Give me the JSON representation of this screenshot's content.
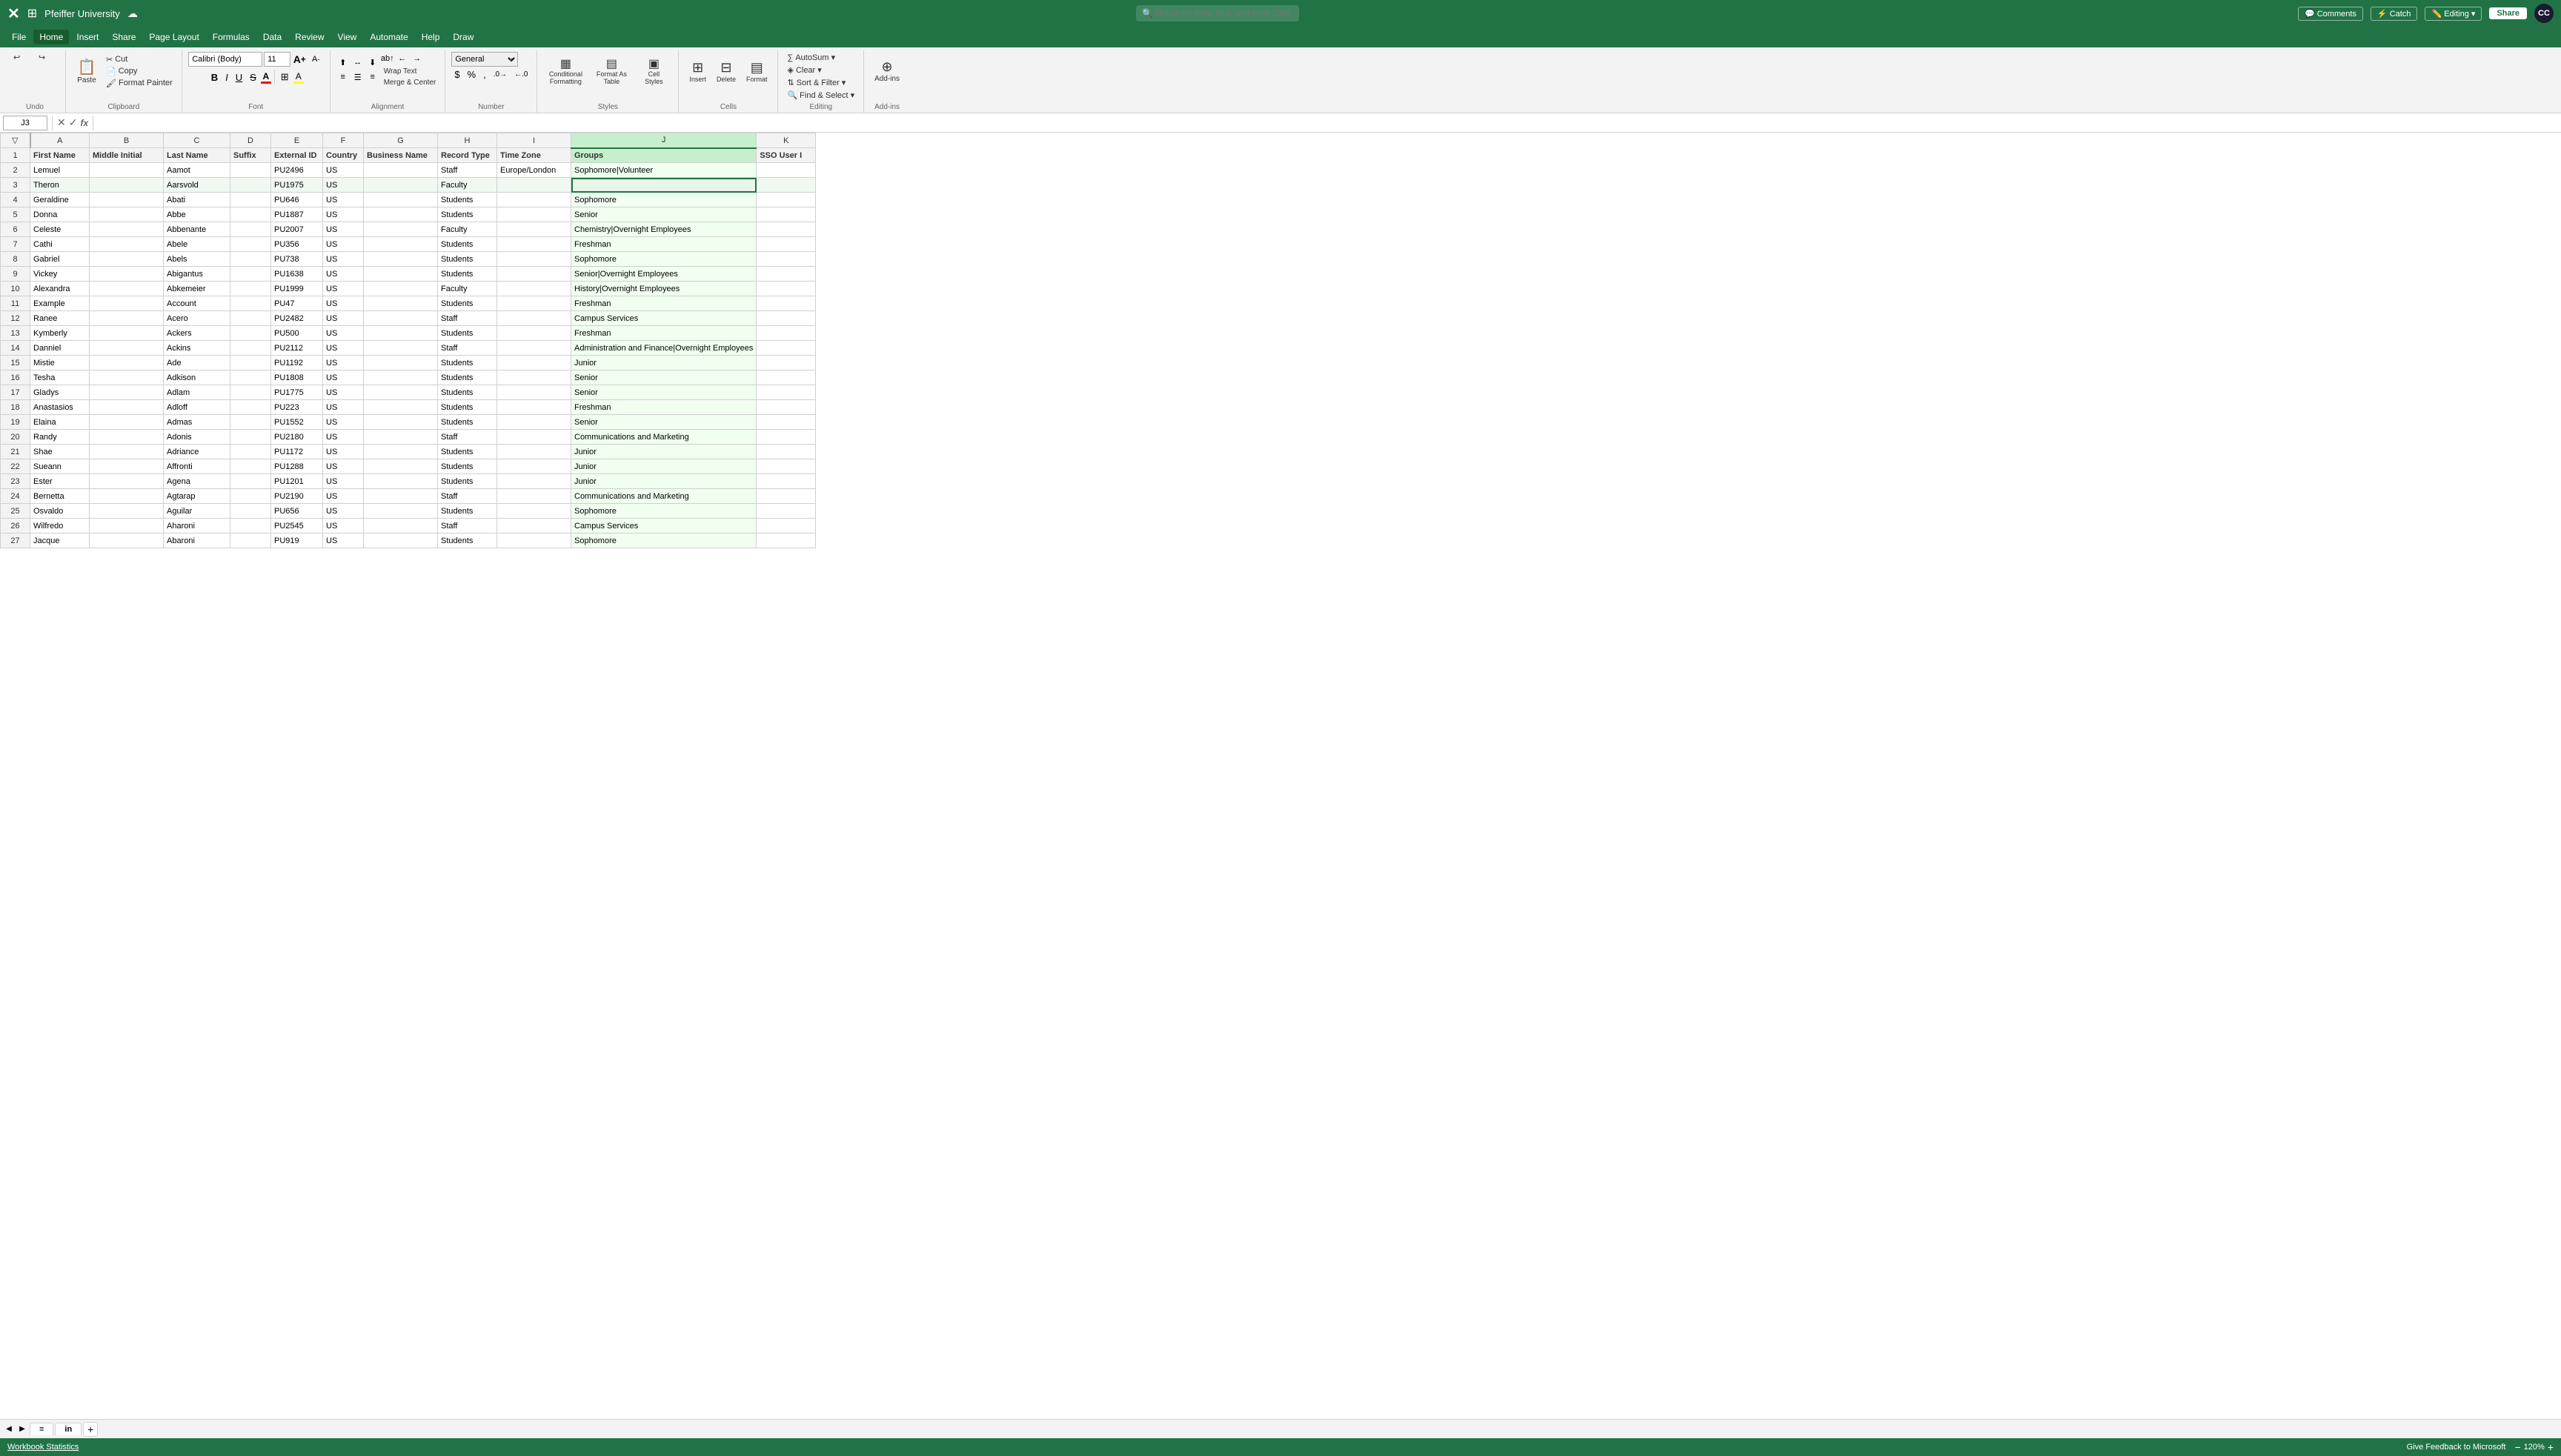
{
  "titleBar": {
    "logo": "X",
    "filename": "Pfeiffer University",
    "cloudIcon": "☁",
    "searchPlaceholder": "Search for tools, help, and more (Option + Q)",
    "catchLabel": "Catch",
    "editingLabel": "Editing",
    "shareLabel": "Share",
    "commentsLabel": "Comments",
    "avatarLabel": "CC"
  },
  "menuBar": {
    "items": [
      "File",
      "Home",
      "Insert",
      "Share",
      "Page Layout",
      "Formulas",
      "Data",
      "Review",
      "View",
      "Automate",
      "Help",
      "Draw"
    ]
  },
  "ribbon": {
    "undo": "↩",
    "redo": "↪",
    "clipboard": {
      "paste": "Paste",
      "cut": "Cut",
      "copy": "Copy",
      "formatPainter": "Format Painter"
    },
    "font": {
      "name": "Calibri (Body)",
      "size": "11",
      "increaseSize": "A",
      "decreaseSize": "A",
      "bold": "B",
      "italic": "I",
      "underline": "U",
      "strikethrough": "S",
      "fontColor": "A",
      "highlightColor": "A"
    },
    "alignment": {
      "wrapText": "Wrap Text",
      "mergeCenter": "Merge & Center",
      "alignLeft": "≡",
      "alignCenter": "≡",
      "alignRight": "≡",
      "indentDecrease": "←",
      "indentIncrease": "→"
    },
    "number": {
      "format": "General",
      "currency": "$",
      "percent": "%",
      "comma": ",",
      "decIncrease": "↑",
      "decDecrease": "↓"
    },
    "styles": {
      "conditional": "Conditional Formatting",
      "formatAsTable": "Format As Table",
      "cellStyles": "Cell Styles"
    },
    "cells": {
      "insert": "Insert",
      "delete": "Delete",
      "format": "Format"
    },
    "editing": {
      "autoSum": "AutoSum",
      "clear": "Clear",
      "sort": "Sort & Filter",
      "findSelect": "Find & Select"
    },
    "addins": {
      "label": "Add-ins"
    }
  },
  "formulaBar": {
    "cellRef": "J3",
    "cancel": "✕",
    "confirm": "✓",
    "fx": "fx",
    "formula": ""
  },
  "columns": {
    "rowHeader": "#",
    "headers": [
      "A",
      "B",
      "C",
      "D",
      "E",
      "F",
      "G",
      "H",
      "I",
      "J",
      "K"
    ],
    "colLabels": [
      "First Name",
      "Middle Initial",
      "Last Name",
      "Suffix",
      "External ID",
      "Country",
      "Business Name",
      "Record Type",
      "Time Zone",
      "Groups",
      "SSO User I"
    ]
  },
  "rows": [
    {
      "num": 2,
      "cells": [
        "Lemuel",
        "",
        "Aamot",
        "",
        "PU2496",
        "US",
        "",
        "Staff",
        "Europe/London",
        "Sophomore|Volunteer",
        ""
      ]
    },
    {
      "num": 3,
      "cells": [
        "Theron",
        "",
        "Aarsvold",
        "",
        "PU1975",
        "US",
        "",
        "Faculty",
        "",
        "",
        ""
      ],
      "selected": true
    },
    {
      "num": 4,
      "cells": [
        "Geraldine",
        "",
        "Abati",
        "",
        "PU646",
        "US",
        "",
        "Students",
        "",
        "Sophomore",
        ""
      ]
    },
    {
      "num": 5,
      "cells": [
        "Donna",
        "",
        "Abbe",
        "",
        "PU1887",
        "US",
        "",
        "Students",
        "",
        "Senior",
        ""
      ]
    },
    {
      "num": 6,
      "cells": [
        "Celeste",
        "",
        "Abbenante",
        "",
        "PU2007",
        "US",
        "",
        "Faculty",
        "",
        "Chemistry|Overnight Employees",
        ""
      ]
    },
    {
      "num": 7,
      "cells": [
        "Cathi",
        "",
        "Abele",
        "",
        "PU356",
        "US",
        "",
        "Students",
        "",
        "Freshman",
        ""
      ]
    },
    {
      "num": 8,
      "cells": [
        "Gabriel",
        "",
        "Abels",
        "",
        "PU738",
        "US",
        "",
        "Students",
        "",
        "Sophomore",
        ""
      ]
    },
    {
      "num": 9,
      "cells": [
        "Vickey",
        "",
        "Abigantus",
        "",
        "PU1638",
        "US",
        "",
        "Students",
        "",
        "Senior|Overnight Employees",
        ""
      ]
    },
    {
      "num": 10,
      "cells": [
        "Alexandra",
        "",
        "Abkemeier",
        "",
        "PU1999",
        "US",
        "",
        "Faculty",
        "",
        "History|Overnight Employees",
        ""
      ]
    },
    {
      "num": 11,
      "cells": [
        "Example",
        "",
        "Account",
        "",
        "PU47",
        "US",
        "",
        "Students",
        "",
        "Freshman",
        ""
      ]
    },
    {
      "num": 12,
      "cells": [
        "Ranee",
        "",
        "Acero",
        "",
        "PU2482",
        "US",
        "",
        "Staff",
        "",
        "Campus Services",
        ""
      ]
    },
    {
      "num": 13,
      "cells": [
        "Kymberly",
        "",
        "Ackers",
        "",
        "PU500",
        "US",
        "",
        "Students",
        "",
        "Freshman",
        ""
      ]
    },
    {
      "num": 14,
      "cells": [
        "Danniel",
        "",
        "Ackins",
        "",
        "PU2112",
        "US",
        "",
        "Staff",
        "",
        "Administration and Finance|Overnight Employees",
        ""
      ]
    },
    {
      "num": 15,
      "cells": [
        "Mistie",
        "",
        "Ade",
        "",
        "PU1192",
        "US",
        "",
        "Students",
        "",
        "Junior",
        ""
      ]
    },
    {
      "num": 16,
      "cells": [
        "Tesha",
        "",
        "Adkison",
        "",
        "PU1808",
        "US",
        "",
        "Students",
        "",
        "Senior",
        ""
      ]
    },
    {
      "num": 17,
      "cells": [
        "Gladys",
        "",
        "Adlam",
        "",
        "PU1775",
        "US",
        "",
        "Students",
        "",
        "Senior",
        ""
      ]
    },
    {
      "num": 18,
      "cells": [
        "Anastasios",
        "",
        "Adloff",
        "",
        "PU223",
        "US",
        "",
        "Students",
        "",
        "Freshman",
        ""
      ]
    },
    {
      "num": 19,
      "cells": [
        "Elaina",
        "",
        "Admas",
        "",
        "PU1552",
        "US",
        "",
        "Students",
        "",
        "Senior",
        ""
      ]
    },
    {
      "num": 20,
      "cells": [
        "Randy",
        "",
        "Adonis",
        "",
        "PU2180",
        "US",
        "",
        "Staff",
        "",
        "Communications and Marketing",
        ""
      ]
    },
    {
      "num": 21,
      "cells": [
        "Shae",
        "",
        "Adriance",
        "",
        "PU1172",
        "US",
        "",
        "Students",
        "",
        "Junior",
        ""
      ]
    },
    {
      "num": 22,
      "cells": [
        "Sueann",
        "",
        "Affronti",
        "",
        "PU1288",
        "US",
        "",
        "Students",
        "",
        "Junior",
        ""
      ]
    },
    {
      "num": 23,
      "cells": [
        "Ester",
        "",
        "Agena",
        "",
        "PU1201",
        "US",
        "",
        "Students",
        "",
        "Junior",
        ""
      ]
    },
    {
      "num": 24,
      "cells": [
        "Bernetta",
        "",
        "Agtarap",
        "",
        "PU2190",
        "US",
        "",
        "Staff",
        "",
        "Communications and Marketing",
        ""
      ]
    },
    {
      "num": 25,
      "cells": [
        "Osvaldo",
        "",
        "Aguilar",
        "",
        "PU656",
        "US",
        "",
        "Students",
        "",
        "Sophomore",
        ""
      ]
    },
    {
      "num": 26,
      "cells": [
        "Wilfredo",
        "",
        "Aharoni",
        "",
        "PU2545",
        "US",
        "",
        "Staff",
        "",
        "Campus Services",
        ""
      ]
    },
    {
      "num": 27,
      "cells": [
        "Jacque",
        "",
        "Abaroni",
        "",
        "PU919",
        "US",
        "",
        "Students",
        "",
        "Sophomore",
        ""
      ]
    }
  ],
  "tabs": {
    "items": [
      "≡",
      "in"
    ],
    "activeTab": "in",
    "addLabel": "+"
  },
  "statusBar": {
    "left": "Workbook Statistics",
    "right": "Give Feedback to Microsoft",
    "zoom": "120%",
    "zoomIn": "+",
    "zoomOut": "-"
  },
  "colors": {
    "excelGreen": "#217346",
    "ribbonBg": "#f3f3f3",
    "selectedCol": "#d4edda",
    "selectedCell": "#e8f5e9",
    "border": "#d0d0d0"
  }
}
